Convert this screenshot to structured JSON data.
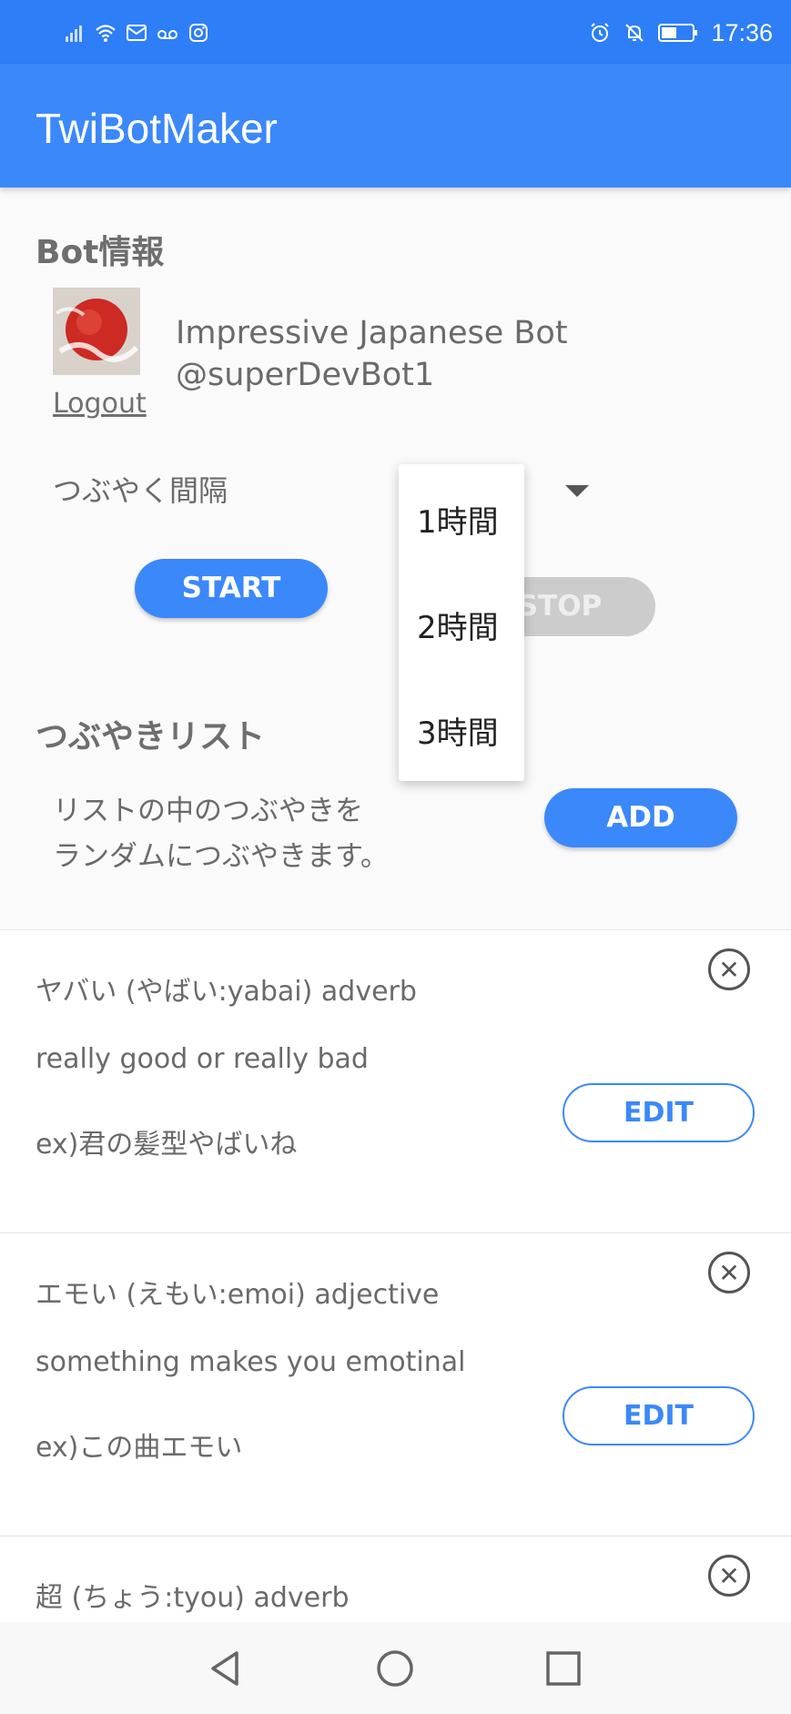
{
  "status_bar": {
    "time": "17:36"
  },
  "app": {
    "title": "TwiBotMaker"
  },
  "bot_info": {
    "heading": "Bot情報",
    "name": "Impressive Japanese Bot",
    "handle": "@superDevBot1",
    "logout_label": "Logout",
    "interval_label": "つぶやく間隔",
    "start_label": "START",
    "stop_label": "STOP"
  },
  "tweet_list": {
    "heading": "つぶやきリスト",
    "description_line1": "リストの中のつぶやきを",
    "description_line2": "ランダムにつぶやきます。",
    "add_label": "ADD",
    "items": [
      {
        "line1": "ヤバい (やばい:yabai) adverb",
        "line2": "really good or really bad",
        "line3": "ex)君の髪型やばいね",
        "edit_label": "EDIT"
      },
      {
        "line1": "エモい (えもい:emoi) adjective",
        "line2": "something makes you emotinal",
        "line3": "ex)この曲エモい",
        "edit_label": "EDIT"
      },
      {
        "line1": "超 (ちょう:tyou) adverb"
      }
    ]
  },
  "interval_dropdown": {
    "options": [
      "1時間",
      "2時間",
      "3時間"
    ]
  },
  "colors": {
    "primary": "#3b88fb",
    "status_bar": "#2d7ef7",
    "disabled": "#cccccc"
  }
}
